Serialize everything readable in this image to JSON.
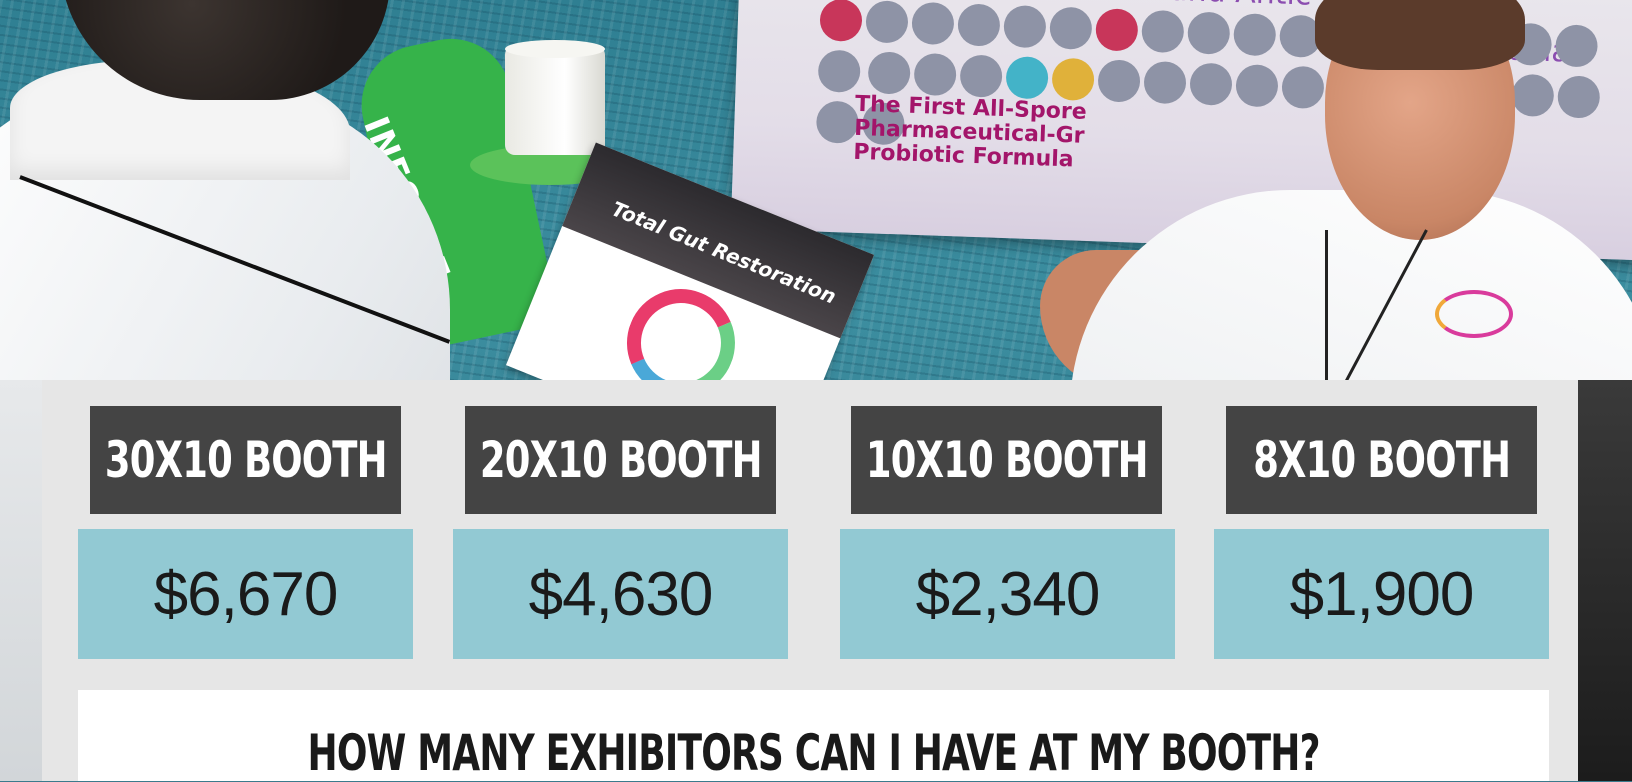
{
  "photo": {
    "banner_title": "obiotic and Antic",
    "banner_title2": "ombina",
    "banner_lines": [
      "The First All-Spore",
      "Pharmaceutical-Gr",
      "Probiotic Formula"
    ],
    "stand_text": "INFORCE",
    "flyer_text": "Total Gut Restoration"
  },
  "booths": [
    {
      "title": "30X10 BOOTH",
      "price": "$6,670"
    },
    {
      "title": "20X10 BOOTH",
      "price": "$4,630"
    },
    {
      "title": "10X10 BOOTH",
      "price": "$2,340"
    },
    {
      "title": "8X10 BOOTH",
      "price": "$1,900"
    }
  ],
  "faq": {
    "title": "HOW MANY EXHIBITORS CAN I HAVE AT MY BOOTH?"
  },
  "colors": {
    "panel": "#e6e6e6",
    "title_bg": "#444444",
    "price_bg": "#92c9d3"
  }
}
